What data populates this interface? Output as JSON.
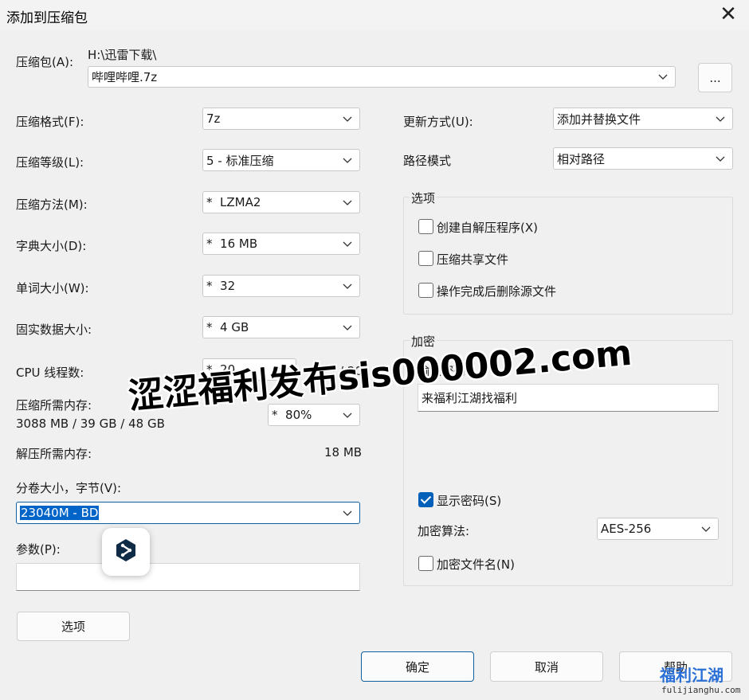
{
  "window": {
    "title": "添加到压缩包",
    "close_glyph": "✕"
  },
  "archive": {
    "label": "压缩包(A):",
    "path": "H:\\迅雷下载\\",
    "name": "哔哩哔哩.7z",
    "browse_label": "..."
  },
  "left": {
    "format": {
      "label": "压缩格式(F):",
      "value": "7z"
    },
    "level": {
      "label": "压缩等级(L):",
      "value": "5 - 标准压缩"
    },
    "method": {
      "label": "压缩方法(M):",
      "value": "*  LZMA2"
    },
    "dict": {
      "label": "字典大小(D):",
      "value": "*  16 MB"
    },
    "word": {
      "label": "单词大小(W):",
      "value": "*  32"
    },
    "solid": {
      "label": "固实数据大小:",
      "value": "*  4 GB"
    },
    "cpu": {
      "label": "CPU 线程数:",
      "value": "*  20",
      "max": "/ 20"
    },
    "mem_comp": {
      "label": "压缩所需内存:",
      "detail": "3088 MB / 39 GB / 48 GB",
      "value": "*  80%"
    },
    "mem_decomp": {
      "label": "解压所需内存:",
      "value": "18 MB"
    },
    "split": {
      "label": "分卷大小，字节(V):",
      "value": "23040M - BD"
    },
    "params": {
      "label": "参数(P):",
      "value": ""
    },
    "options_button": "选项"
  },
  "right": {
    "update": {
      "label": "更新方式(U):",
      "value": "添加并替换文件"
    },
    "pathmode": {
      "label": "路径模式",
      "value": "相对路径"
    },
    "options": {
      "title": "选项",
      "items": [
        {
          "label": "创建自解压程序(X)",
          "checked": false
        },
        {
          "label": "压缩共享文件",
          "checked": false
        },
        {
          "label": "操作完成后删除源文件",
          "checked": false
        }
      ]
    },
    "encryption": {
      "title": "加密",
      "password_label": "输入密码:",
      "password_value": "来福利江湖找福利",
      "show_password": {
        "label": "显示密码(S)",
        "checked": true
      },
      "method_label": "加密算法:",
      "method_value": "AES-256",
      "encrypt_names": {
        "label": "加密文件名(N)",
        "checked": false
      }
    }
  },
  "buttons": {
    "ok": "确定",
    "cancel": "取消",
    "help": "帮助"
  },
  "watermark": {
    "text": "涩涩福利发布sis000002.com"
  },
  "corner_logo": {
    "line1": "福利江湖",
    "line2": "fulijianghu.com"
  },
  "icons": {
    "chevron": "chevron-down-icon",
    "float": "share-icon",
    "close": "close-icon"
  },
  "colors": {
    "accent": "#005fb8",
    "selection": "#0064c8",
    "focus_border": "#0b61a4"
  }
}
